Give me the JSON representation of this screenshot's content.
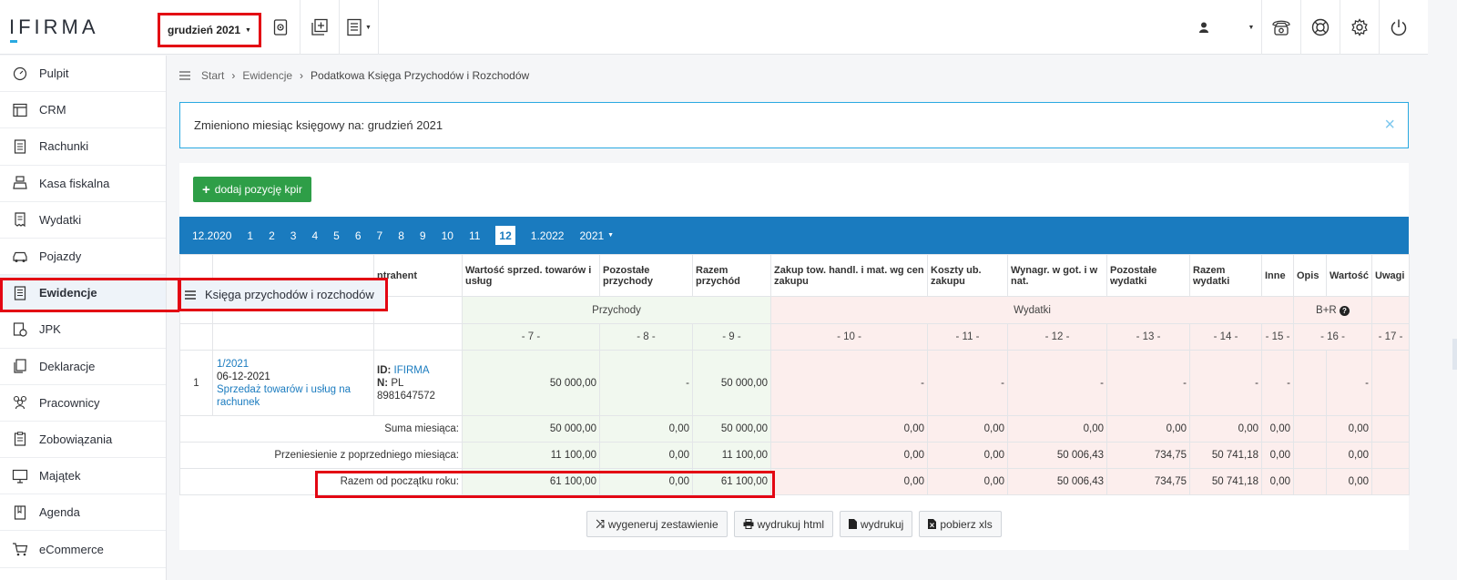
{
  "app": {
    "logo": "IFIRMA",
    "current_month": "grudzień 2021"
  },
  "sidebar": {
    "items": [
      {
        "label": "Pulpit",
        "icon": "gauge-icon"
      },
      {
        "label": "CRM",
        "icon": "layout-icon"
      },
      {
        "label": "Rachunki",
        "icon": "document-icon"
      },
      {
        "label": "Kasa fiskalna",
        "icon": "cash-register-icon"
      },
      {
        "label": "Wydatki",
        "icon": "receipt-icon"
      },
      {
        "label": "Pojazdy",
        "icon": "car-icon"
      },
      {
        "label": "Ewidencje",
        "icon": "ledger-icon"
      },
      {
        "label": "JPK",
        "icon": "jpk-file-icon"
      },
      {
        "label": "Deklaracje",
        "icon": "declarations-icon"
      },
      {
        "label": "Pracownicy",
        "icon": "people-icon"
      },
      {
        "label": "Zobowiązania",
        "icon": "clipboard-icon"
      },
      {
        "label": "Majątek",
        "icon": "monitor-icon"
      },
      {
        "label": "Agenda",
        "icon": "calendar-book-icon"
      },
      {
        "label": "eCommerce",
        "icon": "cart-icon"
      }
    ],
    "popover": "Księga przychodów i rozchodów"
  },
  "breadcrumb": {
    "start": "Start",
    "ewidencje": "Ewidencje",
    "current": "Podatkowa Księga Przychodów i Rozchodów"
  },
  "alert": {
    "text": "Zmieniono miesiąc księgowy na: grudzień 2021",
    "close": "×"
  },
  "toolbar": {
    "add_label": "dodaj pozycję kpir"
  },
  "months": {
    "prev": "12.2020",
    "items": [
      "1",
      "2",
      "3",
      "4",
      "5",
      "6",
      "7",
      "8",
      "9",
      "10",
      "11",
      "12"
    ],
    "active": "12",
    "next": "1.2022",
    "year": "2021"
  },
  "table": {
    "headers": {
      "kontrahent": "ntrahent",
      "c7": "Wartość sprzed. towarów i usług",
      "c8": "Pozostałe przychody",
      "c9": "Razem przychód",
      "c10": "Zakup tow. handl. i mat. wg cen zakupu",
      "c11": "Koszty ub. zakupu",
      "c12": "Wynagr. w got. i w nat.",
      "c13": "Pozostałe wydatki",
      "c14": "Razem wydatki",
      "c15": "Inne",
      "c16a": "Opis",
      "c16b": "Wartość",
      "c17": "Uwagi"
    },
    "sections": {
      "przychody": "Przychody",
      "wydatki": "Wydatki",
      "br": "B+R"
    },
    "col_numbers": [
      "- 7 -",
      "- 8 -",
      "- 9 -",
      "- 10 -",
      "- 11 -",
      "- 12 -",
      "- 13 -",
      "- 14 -",
      "- 15 -",
      "- 16 -",
      "- 17 -"
    ],
    "row": {
      "lp": "1",
      "doc_no": "1/2021",
      "date": "06-12-2021",
      "desc": "Sprzedaż towarów i usług na rachunek",
      "id_label": "ID:",
      "id_value": "IFIRMA",
      "n_label": "N:",
      "n_value": "PL",
      "nip": "8981647572",
      "c7": "50 000,00",
      "c8": "-",
      "c9": "50 000,00",
      "c10": "-",
      "c11": "-",
      "c12": "-",
      "c13": "-",
      "c14": "-",
      "c15": "-",
      "c16": "-"
    },
    "sums": [
      {
        "label": "Suma miesiąca:",
        "c7": "50 000,00",
        "c8": "0,00",
        "c9": "50 000,00",
        "c10": "0,00",
        "c11": "0,00",
        "c12": "0,00",
        "c13": "0,00",
        "c14": "0,00",
        "c15": "0,00",
        "c16": "0,00"
      },
      {
        "label": "Przeniesienie z poprzedniego miesiąca:",
        "c7": "11 100,00",
        "c8": "0,00",
        "c9": "11 100,00",
        "c10": "0,00",
        "c11": "0,00",
        "c12": "50 006,43",
        "c13": "734,75",
        "c14": "50 741,18",
        "c15": "0,00",
        "c16": "0,00"
      },
      {
        "label": "Razem od początku roku:",
        "c7": "61 100,00",
        "c8": "0,00",
        "c9": "61 100,00",
        "c10": "0,00",
        "c11": "0,00",
        "c12": "50 006,43",
        "c13": "734,75",
        "c14": "50 741,18",
        "c15": "0,00",
        "c16": "0,00"
      }
    ]
  },
  "actions": {
    "generate": "wygeneruj zestawienie",
    "print_html": "wydrukuj html",
    "print": "wydrukuj",
    "xls": "pobierz xls"
  },
  "colors": {
    "brand_blue": "#1a7bbf",
    "accent_cyan": "#29a9e1",
    "highlight_red": "#e30613",
    "add_green": "#2e9e47",
    "income_bg": "#f1f8ef",
    "expense_bg": "#fceeed"
  }
}
